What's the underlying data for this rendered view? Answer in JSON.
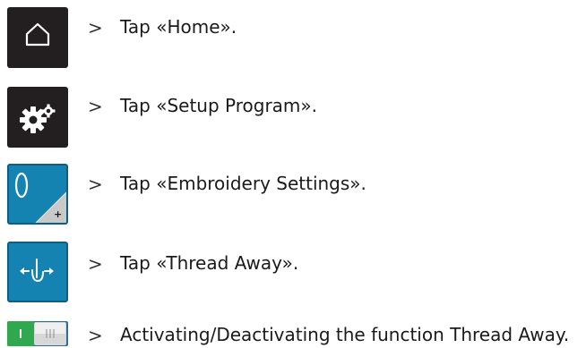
{
  "steps": [
    {
      "icon": "home-icon",
      "arrow": ">",
      "text": "Tap «Home»."
    },
    {
      "icon": "setup-gears-icon",
      "arrow": ">",
      "text": "Tap «Setup Program»."
    },
    {
      "icon": "embroidery-settings-icon",
      "arrow": ">",
      "text": "Tap «Embroidery Settings»."
    },
    {
      "icon": "thread-away-icon",
      "arrow": ">",
      "text": "Tap «Thread Away»."
    },
    {
      "icon": "toggle-switch-icon",
      "arrow": ">",
      "text": "Activating/Deactivating the function Thread Away."
    }
  ],
  "colors": {
    "dark_button": "#231f20",
    "blue_button": "#1483b1",
    "toggle_green": "#2fa84f",
    "toggle_track": "#2a6f9a"
  }
}
